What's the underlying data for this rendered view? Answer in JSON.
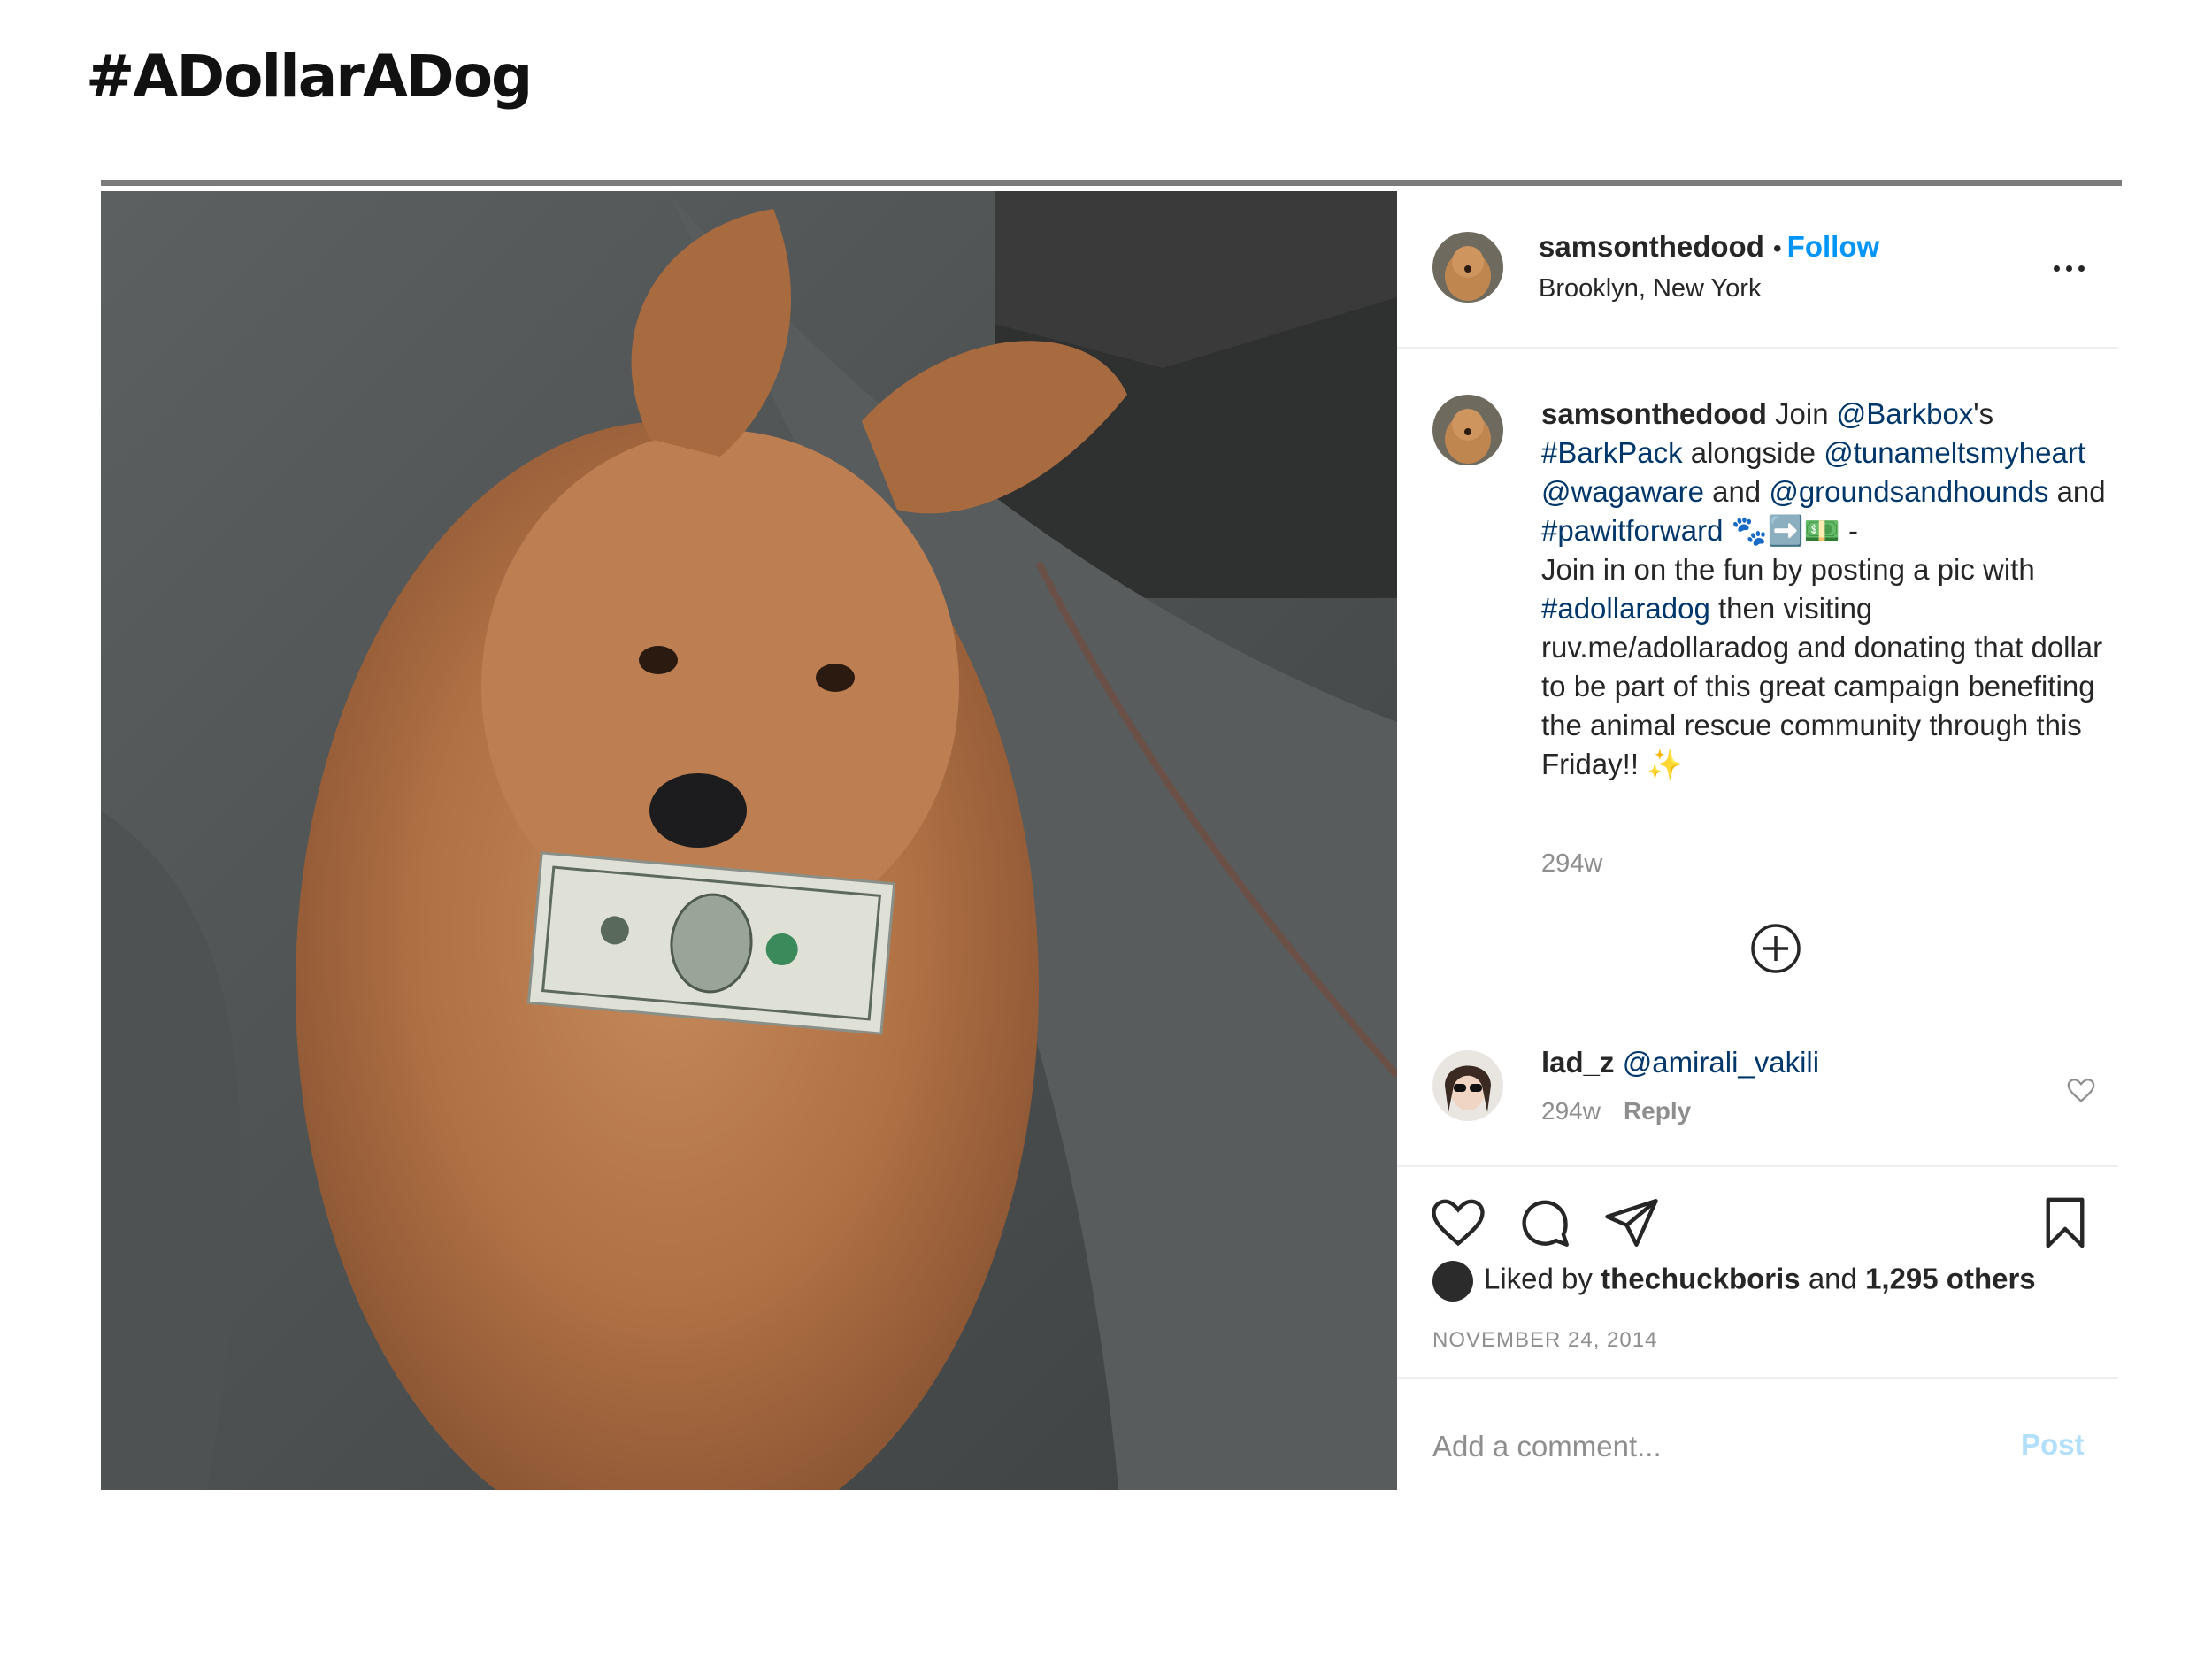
{
  "slide": {
    "title": "#ADollarADog"
  },
  "post": {
    "username": "samsonthedood",
    "separator": "•",
    "follow_label": "Follow",
    "location": "Brooklyn, New York",
    "caption": {
      "author": "samsonthedood",
      "t1": " Join ",
      "m1": "@Barkbox",
      "t2": "'s ",
      "m2": "#BarkPack",
      "t3": " alongside ",
      "m3": "@tunameltsmyheart",
      "t4": " ",
      "m4": "@wagaware",
      "t5": " and ",
      "m5": "@groundsandhounds",
      "t6": " and ",
      "m6": "#pawitforward",
      "t7": " 🐾➡️💵 -",
      "t8": "Join in on the fun by posting a pic with ",
      "m7": "#adollaradog",
      "t9": " then visiting ruv.me/adollaradog and donating that dollar to be part of this great campaign benefiting the animal rescue community through this Friday!! ✨"
    },
    "caption_time": "294w",
    "comment": {
      "username": "lad_z",
      "mention": "@amirali_vakili",
      "time": "294w",
      "reply_label": "Reply"
    },
    "likes": {
      "prefix": "Liked by ",
      "user": "thechuckboris",
      "middle": " and ",
      "count": "1,295 others"
    },
    "date": "NOVEMBER 24, 2014",
    "add_comment_placeholder": "Add a comment...",
    "post_button": "Post"
  },
  "colors": {
    "link": "#00376b",
    "follow": "#0095f6",
    "muted": "#8e8e8e",
    "post_disabled": "#b2dffc"
  },
  "icons": [
    "more-options-icon",
    "add-circle-icon",
    "comment-like-icon",
    "like-icon",
    "comment-icon",
    "share-icon",
    "save-icon"
  ]
}
